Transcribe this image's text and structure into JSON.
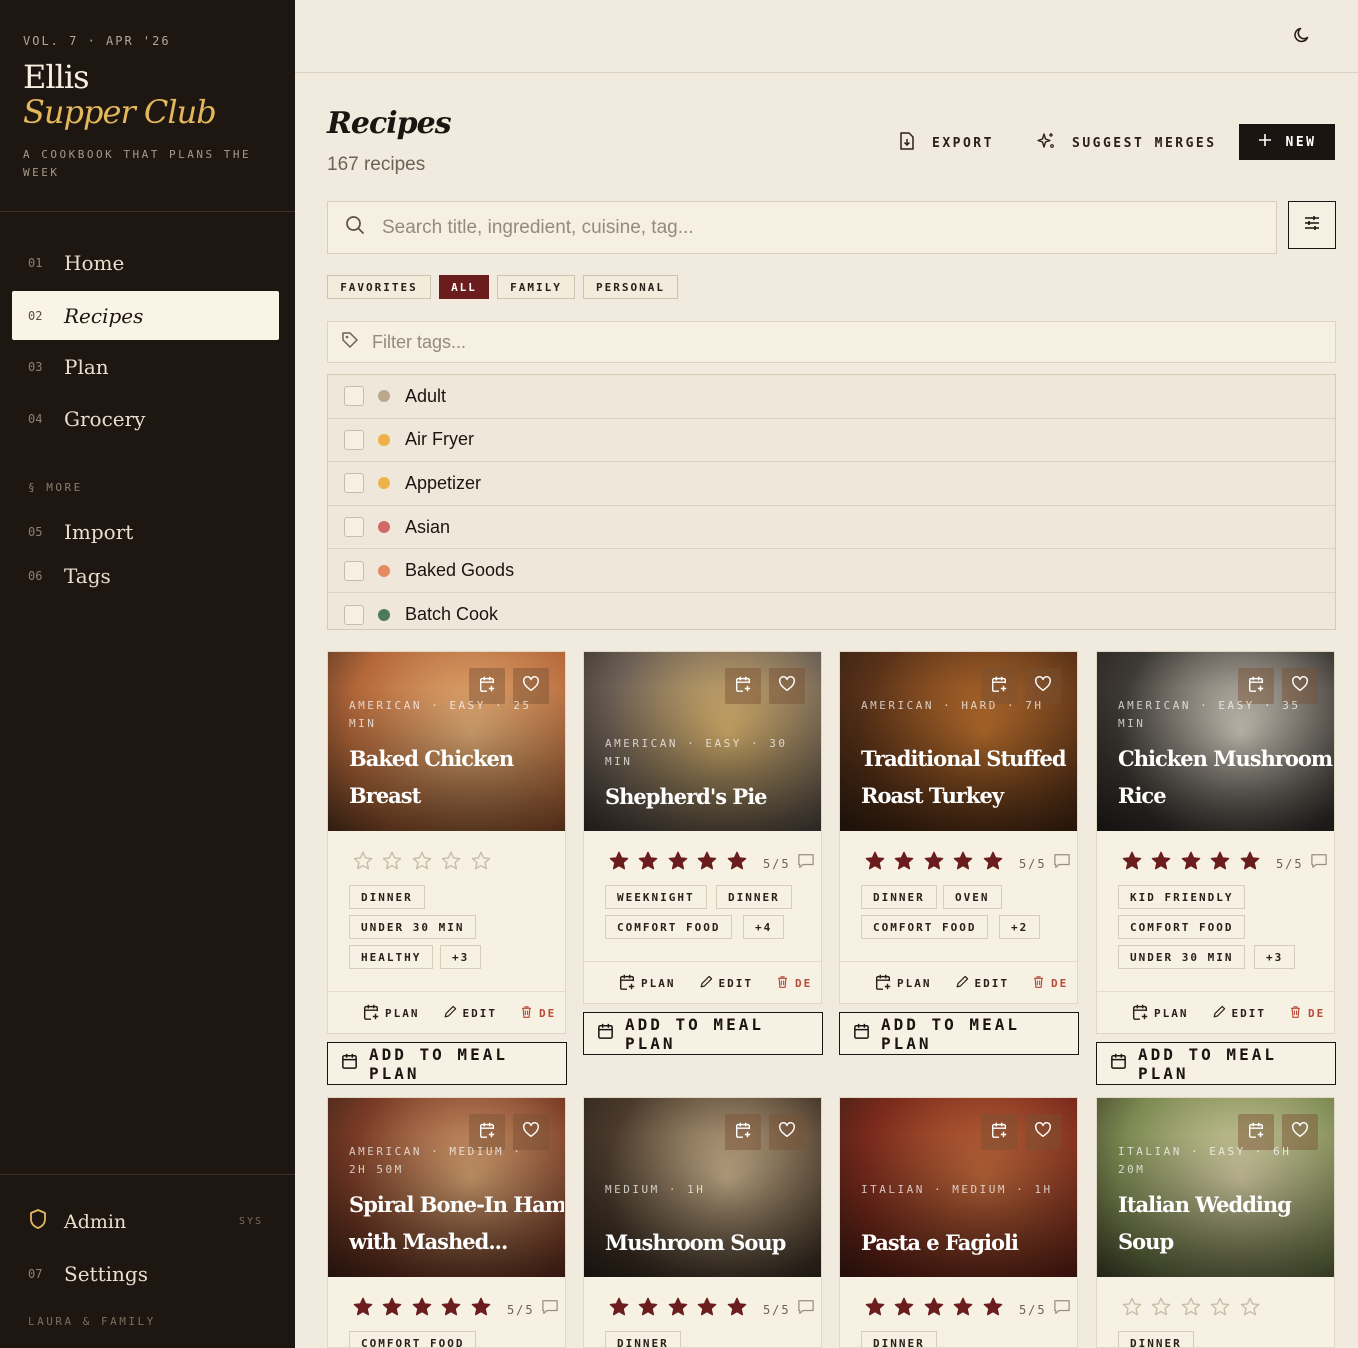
{
  "sidebar": {
    "volume": "VOL. 7 · APR '26",
    "brand_line1": "Ellis",
    "brand_line2": "Supper Club",
    "tagline": "A COOKBOOK THAT PLANS THE WEEK",
    "nav": [
      {
        "num": "01",
        "label": "Home"
      },
      {
        "num": "02",
        "label": "Recipes"
      },
      {
        "num": "03",
        "label": "Plan"
      },
      {
        "num": "04",
        "label": "Grocery"
      }
    ],
    "more_label": "§ MORE",
    "more_nav": [
      {
        "num": "05",
        "label": "Import"
      },
      {
        "num": "06",
        "label": "Tags"
      }
    ],
    "admin_label": "Admin",
    "admin_badge": "SYS",
    "settings": {
      "num": "07",
      "label": "Settings"
    },
    "footer": "LAURA & FAMILY"
  },
  "header": {
    "title": "Recipes",
    "count": "167 recipes",
    "export_label": "EXPORT",
    "merge_label": "SUGGEST MERGES",
    "new_label": "NEW"
  },
  "search": {
    "placeholder": "Search title, ingredient, cuisine, tag..."
  },
  "scopes": [
    "FAVORITES",
    "ALL",
    "FAMILY",
    "PERSONAL"
  ],
  "active_scope": "ALL",
  "tag_filter": {
    "placeholder": "Filter tags..."
  },
  "tags": [
    {
      "label": "Adult",
      "color": "#bca98d"
    },
    {
      "label": "Air Fryer",
      "color": "#edb24a"
    },
    {
      "label": "Appetizer",
      "color": "#edb24a"
    },
    {
      "label": "Asian",
      "color": "#d06a6a"
    },
    {
      "label": "Baked Goods",
      "color": "#e68a62"
    },
    {
      "label": "Batch Cook",
      "color": "#4d7a5a"
    }
  ],
  "card_actions": {
    "plan": "PLAN",
    "edit": "EDIT",
    "delete": "DE",
    "add": "ADD TO MEAL PLAN"
  },
  "recipes": [
    {
      "meta": "AMERICAN · EASY · 25 MIN",
      "title1": "Baked Chicken",
      "title2": "Breast",
      "rating": 0,
      "rating_text": "",
      "tags": [
        "DINNER",
        "UNDER 30 MIN",
        "HEALTHY",
        "+3"
      ],
      "colors": [
        "#b5683a",
        "#e8b37a"
      ]
    },
    {
      "meta": "AMERICAN · EASY · 30 MIN",
      "title1": "Shepherd's Pie",
      "title2": "",
      "rating": 5,
      "rating_text": "5/5",
      "tags": [
        "WEEKNIGHT",
        "DINNER",
        "COMFORT FOOD",
        "+4"
      ],
      "colors": [
        "#6b5f55",
        "#e0b870"
      ]
    },
    {
      "meta": "AMERICAN · HARD · 7H",
      "title1": "Traditional Stuffed",
      "title2": "Roast Turkey",
      "rating": 5,
      "rating_text": "5/5",
      "tags": [
        "DINNER",
        "OVEN",
        "COMFORT FOOD",
        "+2"
      ],
      "colors": [
        "#5a3218",
        "#c0722e"
      ]
    },
    {
      "meta": "AMERICAN · EASY · 35 MIN",
      "title1": "Chicken Mushroom",
      "title2": "Rice",
      "rating": 5,
      "rating_text": "5/5",
      "tags": [
        "KID FRIENDLY",
        "COMFORT FOOD",
        "UNDER 30 MIN",
        "+3"
      ],
      "colors": [
        "#3e3a35",
        "#d8d1c4"
      ]
    },
    {
      "meta": "AMERICAN · MEDIUM · 2H 50M",
      "title1": "Spiral Bone-In Ham",
      "title2": "with Mashed...",
      "rating": 5,
      "rating_text": "5/5",
      "tags": [
        "COMFORT FOOD"
      ],
      "colors": [
        "#7a3b26",
        "#d9a574"
      ]
    },
    {
      "meta": "MEDIUM · 1H",
      "title1": "Mushroom Soup",
      "title2": "",
      "rating": 5,
      "rating_text": "5/5",
      "tags": [
        "DINNER"
      ],
      "colors": [
        "#4a3a2c",
        "#cdb48e"
      ]
    },
    {
      "meta": "ITALIAN · MEDIUM · 1H",
      "title1": "Pasta e Fagioli",
      "title2": "",
      "rating": 5,
      "rating_text": "5/5",
      "tags": [
        "DINNER"
      ],
      "colors": [
        "#7a2a1c",
        "#c36b3c"
      ]
    },
    {
      "meta": "ITALIAN · EASY · 6H 20M",
      "title1": "Italian Wedding",
      "title2": "Soup",
      "rating": 0,
      "rating_text": "",
      "tags": [
        "DINNER"
      ],
      "colors": [
        "#7d8a52",
        "#d7cfa6"
      ]
    }
  ]
}
